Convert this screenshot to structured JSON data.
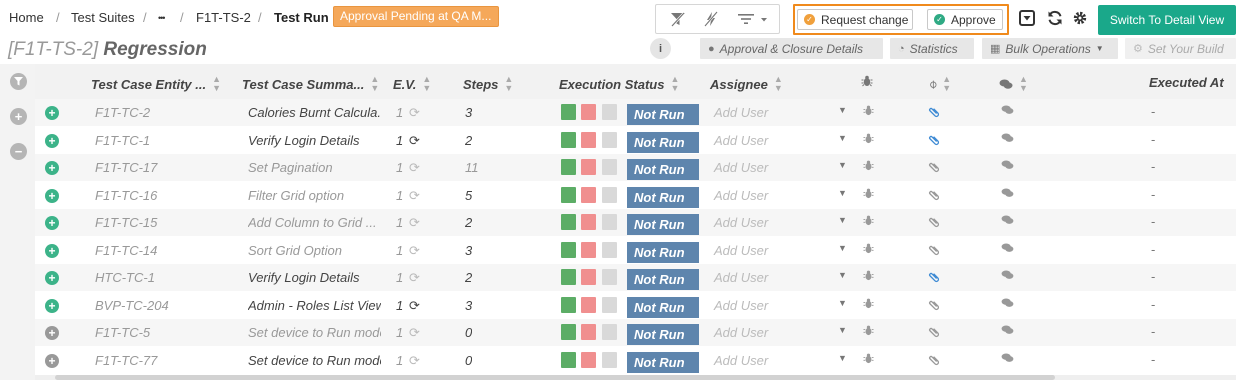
{
  "breadcrumb": {
    "items": [
      "Home",
      "Test Suites",
      "•••",
      "F1T-TS-2"
    ],
    "current": "Test Run",
    "separator": "/"
  },
  "status_badge": "Approval Pending at QA M...",
  "toolbar": {
    "request_change_label": "Request change",
    "approve_label": "Approve",
    "switch_label": "Switch To Detail View"
  },
  "title": {
    "id": "[F1T-TS-2]",
    "name": "Regression"
  },
  "sub_toolbar": {
    "info_label": "i",
    "approval_label": "Approval & Closure Details",
    "statistics_label": "Statistics",
    "bulk_label": "Bulk Operations",
    "build_label": "Set Your Build"
  },
  "columns": {
    "entity": "Test Case Entity ...",
    "summary": "Test Case Summa...",
    "ev": "E.V.",
    "steps": "Steps",
    "status": "Execution Status",
    "assignee": "Assignee",
    "executed": "Executed At"
  },
  "rows": [
    {
      "id": "F1T-TC-2",
      "summary": "Calories Burnt Calcula...",
      "ev": "1",
      "steps": "3",
      "status": "Not Run",
      "assignee": "Add User",
      "executed": "-"
    },
    {
      "id": "F1T-TC-1",
      "summary": "Verify Login Details",
      "ev": "1",
      "steps": "2",
      "status": "Not Run",
      "assignee": "Add User",
      "executed": "-"
    },
    {
      "id": "F1T-TC-17",
      "summary": "Set Pagination",
      "ev": "1",
      "steps": "11",
      "status": "Not Run",
      "assignee": "Add User",
      "executed": "-"
    },
    {
      "id": "F1T-TC-16",
      "summary": "Filter Grid option",
      "ev": "1",
      "steps": "5",
      "status": "Not Run",
      "assignee": "Add User",
      "executed": "-"
    },
    {
      "id": "F1T-TC-15",
      "summary": "Add Column to Grid ...",
      "ev": "1",
      "steps": "2",
      "status": "Not Run",
      "assignee": "Add User",
      "executed": "-"
    },
    {
      "id": "F1T-TC-14",
      "summary": "Sort Grid Option",
      "ev": "1",
      "steps": "3",
      "status": "Not Run",
      "assignee": "Add User",
      "executed": "-"
    },
    {
      "id": "HTC-TC-1",
      "summary": "Verify Login Details",
      "ev": "1",
      "steps": "2",
      "status": "Not Run",
      "assignee": "Add User",
      "executed": "-"
    },
    {
      "id": "BVP-TC-204",
      "summary": "Admin - Roles List View",
      "ev": "1",
      "steps": "3",
      "status": "Not Run",
      "assignee": "Add User",
      "executed": "-"
    },
    {
      "id": "F1T-TC-5",
      "summary": "Set device to Run mode",
      "ev": "1",
      "steps": "0",
      "status": "Not Run",
      "assignee": "Add User",
      "executed": "-"
    },
    {
      "id": "F1T-TC-77",
      "summary": "Set device to Run mode",
      "ev": "1",
      "steps": "0",
      "status": "Not Run",
      "assignee": "Add User",
      "executed": "-"
    }
  ],
  "colors": {
    "accent": "#1aa88a",
    "badge": "#f5a85a",
    "highlight": "#f08a1c",
    "status_not_run": "#5e85ad"
  }
}
